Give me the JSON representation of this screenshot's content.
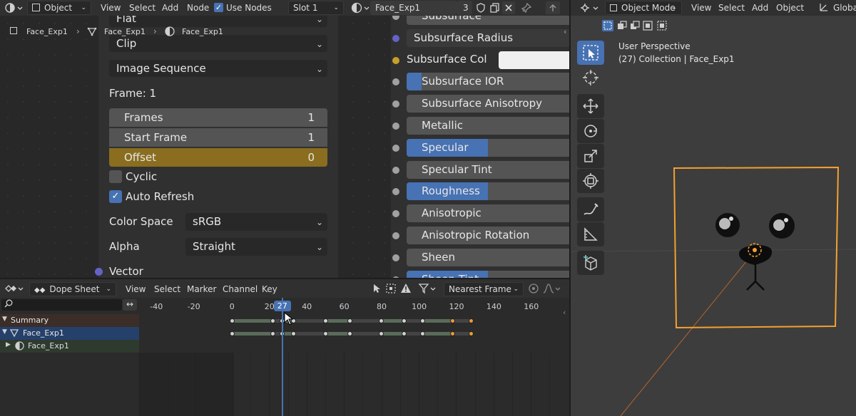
{
  "node_editor": {
    "header": {
      "object_dropdown": "Object",
      "menu": [
        "View",
        "Select",
        "Add",
        "Node"
      ],
      "use_nodes_label": "Use Nodes",
      "slot_dropdown": "Slot 1",
      "material_name": "Face_Exp1",
      "user_count": "3"
    },
    "breadcrumb": [
      "Face_Exp1",
      "Face_Exp1",
      "Face_Exp1"
    ],
    "image_node": {
      "flat_dropdown": "Flat",
      "clip_dropdown": "Clip",
      "source_dropdown": "Image Sequence",
      "frame_label": "Frame: 1",
      "fields": [
        {
          "label": "Frames",
          "value": "1"
        },
        {
          "label": "Start Frame",
          "value": "1"
        },
        {
          "label": "Offset",
          "value": "0"
        }
      ],
      "cyclic_label": "Cyclic",
      "cyclic_checked": false,
      "auto_refresh_label": "Auto Refresh",
      "auto_refresh_checked": true,
      "color_space_label": "Color Space",
      "color_space_value": "sRGB",
      "alpha_label": "Alpha",
      "alpha_value": "Straight",
      "vector_label": "Vector"
    },
    "bsdf_node": {
      "rows": [
        {
          "label": "Subsurface",
          "fill": 0,
          "socket": "gray"
        },
        {
          "label": "Subsurface Radius",
          "fill": 0,
          "socket": "blue",
          "dropdown": true
        },
        {
          "label": "Subsurface Col",
          "fill": 0,
          "socket": "yellow",
          "color_field": true
        },
        {
          "label": "Subsurface IOR",
          "fill": 0.09,
          "socket": "gray"
        },
        {
          "label": "Subsurface Anisotropy",
          "fill": 0,
          "socket": "gray"
        },
        {
          "label": "Metallic",
          "fill": 0,
          "socket": "gray"
        },
        {
          "label": "Specular",
          "fill": 0.5,
          "socket": "gray"
        },
        {
          "label": "Specular Tint",
          "fill": 0,
          "socket": "gray"
        },
        {
          "label": "Roughness",
          "fill": 0.5,
          "socket": "gray"
        },
        {
          "label": "Anisotropic",
          "fill": 0,
          "socket": "gray"
        },
        {
          "label": "Anisotropic Rotation",
          "fill": 0,
          "socket": "gray"
        },
        {
          "label": "Sheen",
          "fill": 0,
          "socket": "gray"
        },
        {
          "label": "Sheen Tint",
          "fill": 0.5,
          "socket": "gray"
        }
      ]
    }
  },
  "dope_sheet": {
    "header": {
      "mode_dropdown": "Dope Sheet",
      "menu": [
        "View",
        "Select",
        "Marker",
        "Channel",
        "Key"
      ],
      "snap_dropdown": "Nearest Frame"
    },
    "search_placeholder": "",
    "current_frame": "27",
    "ticks": [
      "-40",
      "-20",
      "0",
      "20",
      "40",
      "60",
      "80",
      "100",
      "120",
      "140",
      "160"
    ],
    "channels": [
      {
        "label": "Summary"
      },
      {
        "label": "Face_Exp1"
      },
      {
        "label": "Face_Exp1"
      }
    ],
    "keyframes": [
      0,
      22,
      27,
      33,
      50,
      63,
      80,
      92,
      102,
      118,
      128
    ]
  },
  "viewport": {
    "header": {
      "mode_dropdown": "Object Mode",
      "menu": [
        "View",
        "Select",
        "Add",
        "Object"
      ],
      "orientation": "Global"
    },
    "overlay_title": "User Perspective",
    "overlay_collection": "(27) Collection | Face_Exp1"
  },
  "colors": {
    "accent_blue": "#4772b3",
    "selected_orange": "#e89b3a",
    "offset_field": "#8a6d1f"
  }
}
